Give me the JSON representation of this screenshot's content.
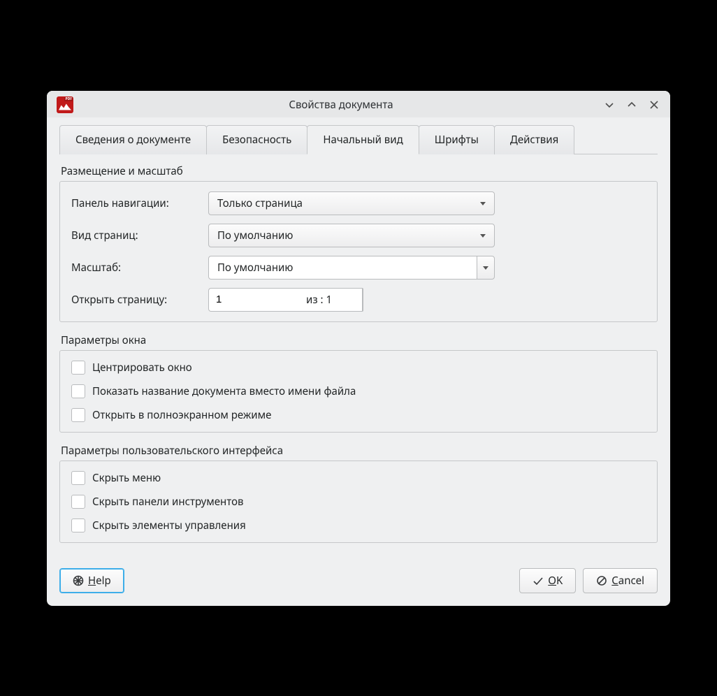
{
  "window": {
    "title": "Свойства документа"
  },
  "tabs": {
    "t0": "Сведения о документе",
    "t1": "Безопасность",
    "t2": "Начальный вид",
    "t3": "Шрифты",
    "t4": "Действия"
  },
  "layout": {
    "group_label": "Размещение и масштаб",
    "nav_label": "Панель навигации:",
    "nav_value": "Только страница",
    "pagelayout_label": "Вид страниц:",
    "pagelayout_value": "По умолчанию",
    "zoom_label": "Масштаб:",
    "zoom_value": "По умолчанию",
    "openpage_label": "Открыть страницу:",
    "openpage_value": "1",
    "of_text": "из : 1"
  },
  "window_opts": {
    "group_label": "Параметры окна",
    "center": "Центрировать окно",
    "show_title": "Показать название документа вместо имени файла",
    "fullscreen": "Открыть в полноэкранном режиме"
  },
  "ui_opts": {
    "group_label": "Параметры пользовательского интерфейса",
    "hide_menu": "Скрыть меню",
    "hide_toolbars": "Скрыть панели инструментов",
    "hide_controls": "Скрыть элементы управления"
  },
  "buttons": {
    "help": "Help",
    "ok": "OK",
    "cancel": "Cancel"
  }
}
